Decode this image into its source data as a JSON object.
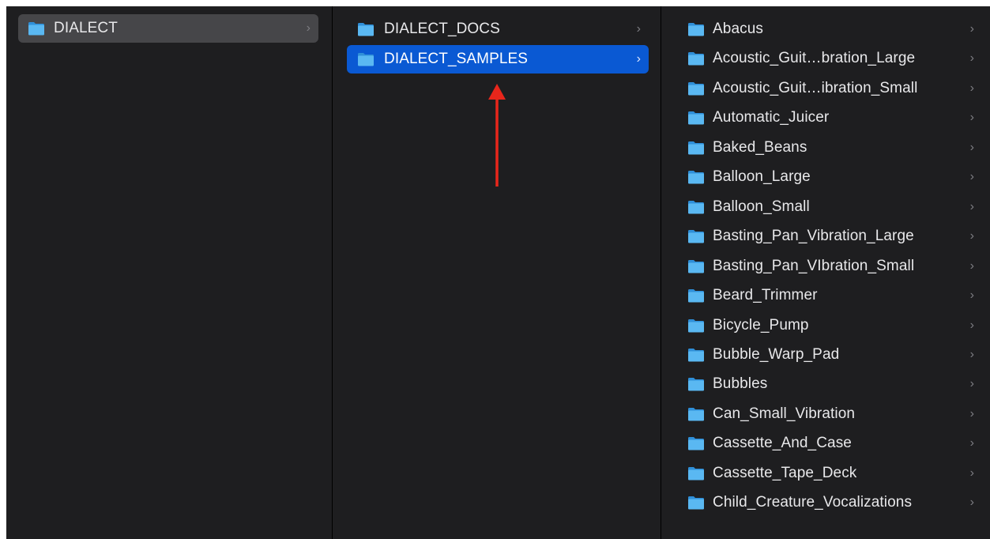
{
  "columns": [
    {
      "items": [
        {
          "label": "DIALECT",
          "selected": "inactive"
        }
      ]
    },
    {
      "items": [
        {
          "label": "DIALECT_DOCS",
          "selected": "none"
        },
        {
          "label": "DIALECT_SAMPLES",
          "selected": "active"
        }
      ]
    },
    {
      "items": [
        {
          "label": "Abacus"
        },
        {
          "label": "Acoustic_Guit…bration_Large"
        },
        {
          "label": "Acoustic_Guit…ibration_Small"
        },
        {
          "label": "Automatic_Juicer"
        },
        {
          "label": "Baked_Beans"
        },
        {
          "label": "Balloon_Large"
        },
        {
          "label": "Balloon_Small"
        },
        {
          "label": "Basting_Pan_Vibration_Large"
        },
        {
          "label": "Basting_Pan_VIbration_Small"
        },
        {
          "label": "Beard_Trimmer"
        },
        {
          "label": "Bicycle_Pump"
        },
        {
          "label": "Bubble_Warp_Pad"
        },
        {
          "label": "Bubbles"
        },
        {
          "label": "Can_Small_Vibration"
        },
        {
          "label": "Cassette_And_Case"
        },
        {
          "label": "Cassette_Tape_Deck"
        },
        {
          "label": "Child_Creature_Vocalizations"
        }
      ]
    }
  ],
  "icons": {
    "folder": "folder-icon",
    "chevron": "chevron-right-icon",
    "chevron_glyph": "›"
  },
  "colors": {
    "window_bg": "#1e1e20",
    "selection_active": "#0a59d3",
    "selection_inactive": "#464649",
    "folder_blue": "#4aa8ec",
    "annotation_arrow": "#e8261b"
  }
}
